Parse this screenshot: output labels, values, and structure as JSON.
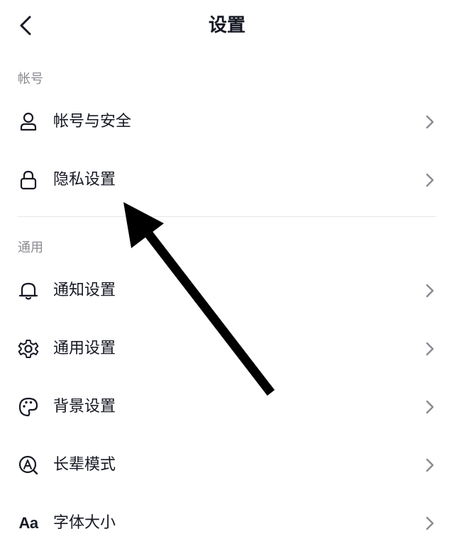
{
  "header": {
    "title": "设置",
    "back_icon": "chevron-left-icon"
  },
  "sections": [
    {
      "label": "帐号",
      "items": [
        {
          "label": "帐号与安全",
          "icon": "user-icon"
        },
        {
          "label": "隐私设置",
          "icon": "lock-icon"
        }
      ]
    },
    {
      "label": "通用",
      "items": [
        {
          "label": "通知设置",
          "icon": "bell-icon"
        },
        {
          "label": "通用设置",
          "icon": "gear-icon"
        },
        {
          "label": "背景设置",
          "icon": "palette-icon"
        },
        {
          "label": "长辈模式",
          "icon": "elder-mode-icon"
        },
        {
          "label": "字体大小",
          "icon": "font-size-icon",
          "glyph": "Aa"
        }
      ]
    }
  ],
  "annotation": {
    "type": "arrow",
    "color": "#000000",
    "points_to": "隐私设置"
  },
  "colors": {
    "text_primary": "#161823",
    "text_secondary": "#8a8b91",
    "chevron": "#8a8b91",
    "divider": "#e6e6e8",
    "background": "#ffffff"
  }
}
